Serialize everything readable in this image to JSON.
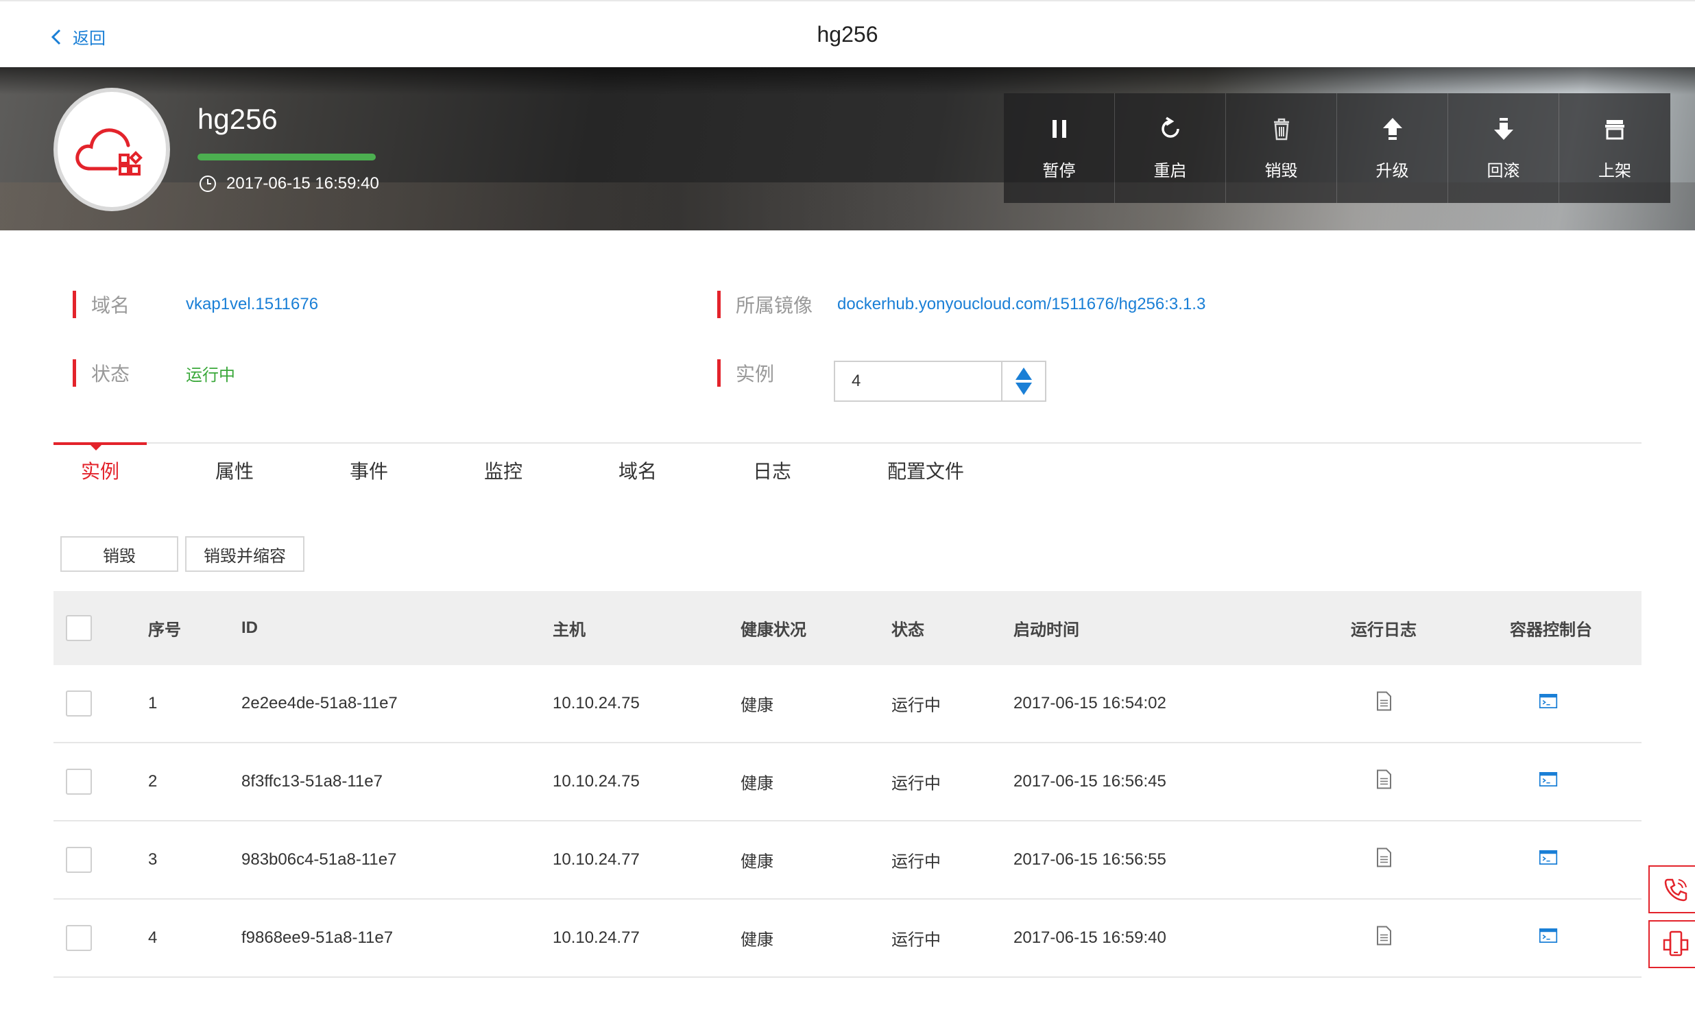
{
  "nav": {
    "back_label": "返回",
    "title": "hg256"
  },
  "app": {
    "name": "hg256",
    "progress": 1.0,
    "created_at": "2017-06-15 16:59:40"
  },
  "actions": [
    {
      "label": "暂停",
      "icon": "pause-icon"
    },
    {
      "label": "重启",
      "icon": "restart-icon"
    },
    {
      "label": "销毁",
      "icon": "trash-icon"
    },
    {
      "label": "升级",
      "icon": "upgrade-icon"
    },
    {
      "label": "回滚",
      "icon": "rollback-icon"
    },
    {
      "label": "上架",
      "icon": "store-icon"
    }
  ],
  "info": {
    "domain_label": "域名",
    "domain_value": "vkap1vel.1511676",
    "image_label": "所属镜像",
    "image_value": "dockerhub.yonyoucloud.com/1511676/hg256:3.1.3",
    "status_label": "状态",
    "status_value": "运行中",
    "instances_label": "实例",
    "instances_value": "4"
  },
  "tabs": [
    "实例",
    "属性",
    "事件",
    "监控",
    "域名",
    "日志",
    "配置文件"
  ],
  "buttons": {
    "destroy": "销毁",
    "destroy_scale": "销毁并缩容"
  },
  "table": {
    "headers": [
      "序号",
      "ID",
      "主机",
      "健康状况",
      "状态",
      "启动时间",
      "运行日志",
      "容器控制台"
    ],
    "rows": [
      [
        "1",
        "2e2ee4de-51a8-11e7",
        "10.10.24.75",
        "健康",
        "运行中",
        "2017-06-15 16:54:02"
      ],
      [
        "2",
        "8f3ffc13-51a8-11e7",
        "10.10.24.75",
        "健康",
        "运行中",
        "2017-06-15 16:56:45"
      ],
      [
        "3",
        "983b06c4-51a8-11e7",
        "10.10.24.77",
        "健康",
        "运行中",
        "2017-06-15 16:56:55"
      ],
      [
        "4",
        "f9868ee9-51a8-11e7",
        "10.10.24.77",
        "健康",
        "运行中",
        "2017-06-15 16:59:40"
      ]
    ]
  },
  "colors": {
    "accent": "#e3232b",
    "link": "#1a7fd6",
    "running": "#3aa83a"
  }
}
